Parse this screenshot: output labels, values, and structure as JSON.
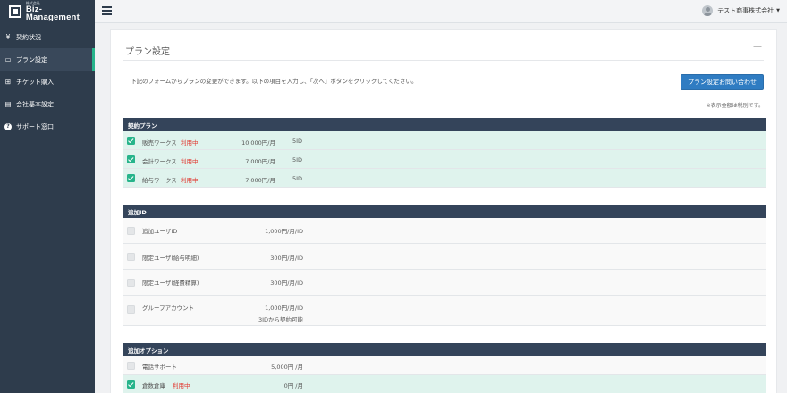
{
  "sidebar": {
    "logo_small": "株式会社",
    "logo_main": "Biz-Management",
    "items": [
      {
        "icon": "yen-icon",
        "glyph": "¥",
        "label": "契約状況"
      },
      {
        "icon": "card-icon",
        "glyph": "▭",
        "label": "プラン設定"
      },
      {
        "icon": "plus-square-icon",
        "glyph": "⊞",
        "label": "チケット購入"
      },
      {
        "icon": "document-icon",
        "glyph": "▤",
        "label": "会社基本設定"
      },
      {
        "icon": "question-circle-icon",
        "glyph": "?",
        "label": "サポート窓口"
      }
    ]
  },
  "header": {
    "user_name": "テスト商事株式会社",
    "caret": "▼"
  },
  "panel": {
    "title": "プラン設定",
    "collapse": "—",
    "lead": "下記のフォームからプランの変更ができます。以下の項目を入力し、「次へ」ボタンをクリックしてください。",
    "contact_button": "プラン設定お問い合わせ",
    "tax_note": "※表示金額は税別です。"
  },
  "in_use_label": "利用中",
  "contract_plan": {
    "heading": "契約プラン",
    "rows": [
      {
        "name": "販売ワークス",
        "in_use": true,
        "price": "10,000円/月",
        "qty": "5ID",
        "checked": true
      },
      {
        "name": "会計ワークス",
        "in_use": true,
        "price": "7,000円/月",
        "qty": "5ID",
        "checked": true
      },
      {
        "name": "給与ワークス",
        "in_use": true,
        "price": "7,000円/月",
        "qty": "5ID",
        "checked": true
      }
    ]
  },
  "additional_id": {
    "heading": "追加ID",
    "rows": [
      {
        "name": "追加ユーザID",
        "price": "1,000円/月/ID",
        "checked": false
      },
      {
        "name": "限定ユーザ(給与明細)",
        "price": "300円/月/ID",
        "checked": false
      },
      {
        "name": "限定ユーザ(経費精算)",
        "price": "300円/月/ID",
        "checked": false
      },
      {
        "name": "グループアカウント",
        "price": "1,000円/月/ID",
        "extra": "3IDから契約可能",
        "checked": false
      }
    ]
  },
  "additional_options": {
    "heading": "追加オプション",
    "rows": [
      {
        "name": "電話サポート",
        "in_use": false,
        "price": "5,000円 /月",
        "checked": false
      },
      {
        "name": "倉数倉庫",
        "in_use": true,
        "price": "0円 /月",
        "checked": true
      }
    ]
  }
}
